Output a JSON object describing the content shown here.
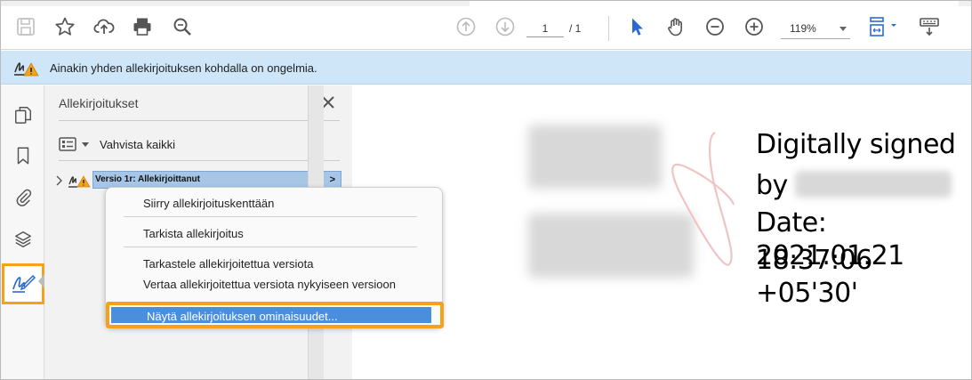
{
  "toolbar": {
    "page_current": "1",
    "page_total": "/ 1",
    "zoom": "119%"
  },
  "banner": {
    "message": "Ainakin yhden allekirjoituksen kohdalla on ongelmia."
  },
  "panel": {
    "title": "Allekirjoitukset",
    "validate_all": "Vahvista kaikki",
    "tree_item": "Versio 1r: Allekirjoittanut",
    "tree_item_arrow": ">"
  },
  "context_menu": {
    "items": [
      "Siirry allekirjoituskenttään",
      "Tarkista allekirjoitus",
      "Tarkastele allekirjoitettua versiota",
      "Vertaa allekirjoitettua versiota nykyiseen versioon",
      "Näytä allekirjoituksen ominaisuudet..."
    ]
  },
  "document": {
    "line1": "Digitally signed",
    "line2": "by",
    "line3": "Date: 2021.01.21",
    "line4": "18:37:06 +05'30'"
  },
  "colors": {
    "accent": "#f4a21a",
    "selection": "#4a8fdc",
    "banner": "#cfe6f8",
    "tool_blue": "#2a6ad0"
  }
}
